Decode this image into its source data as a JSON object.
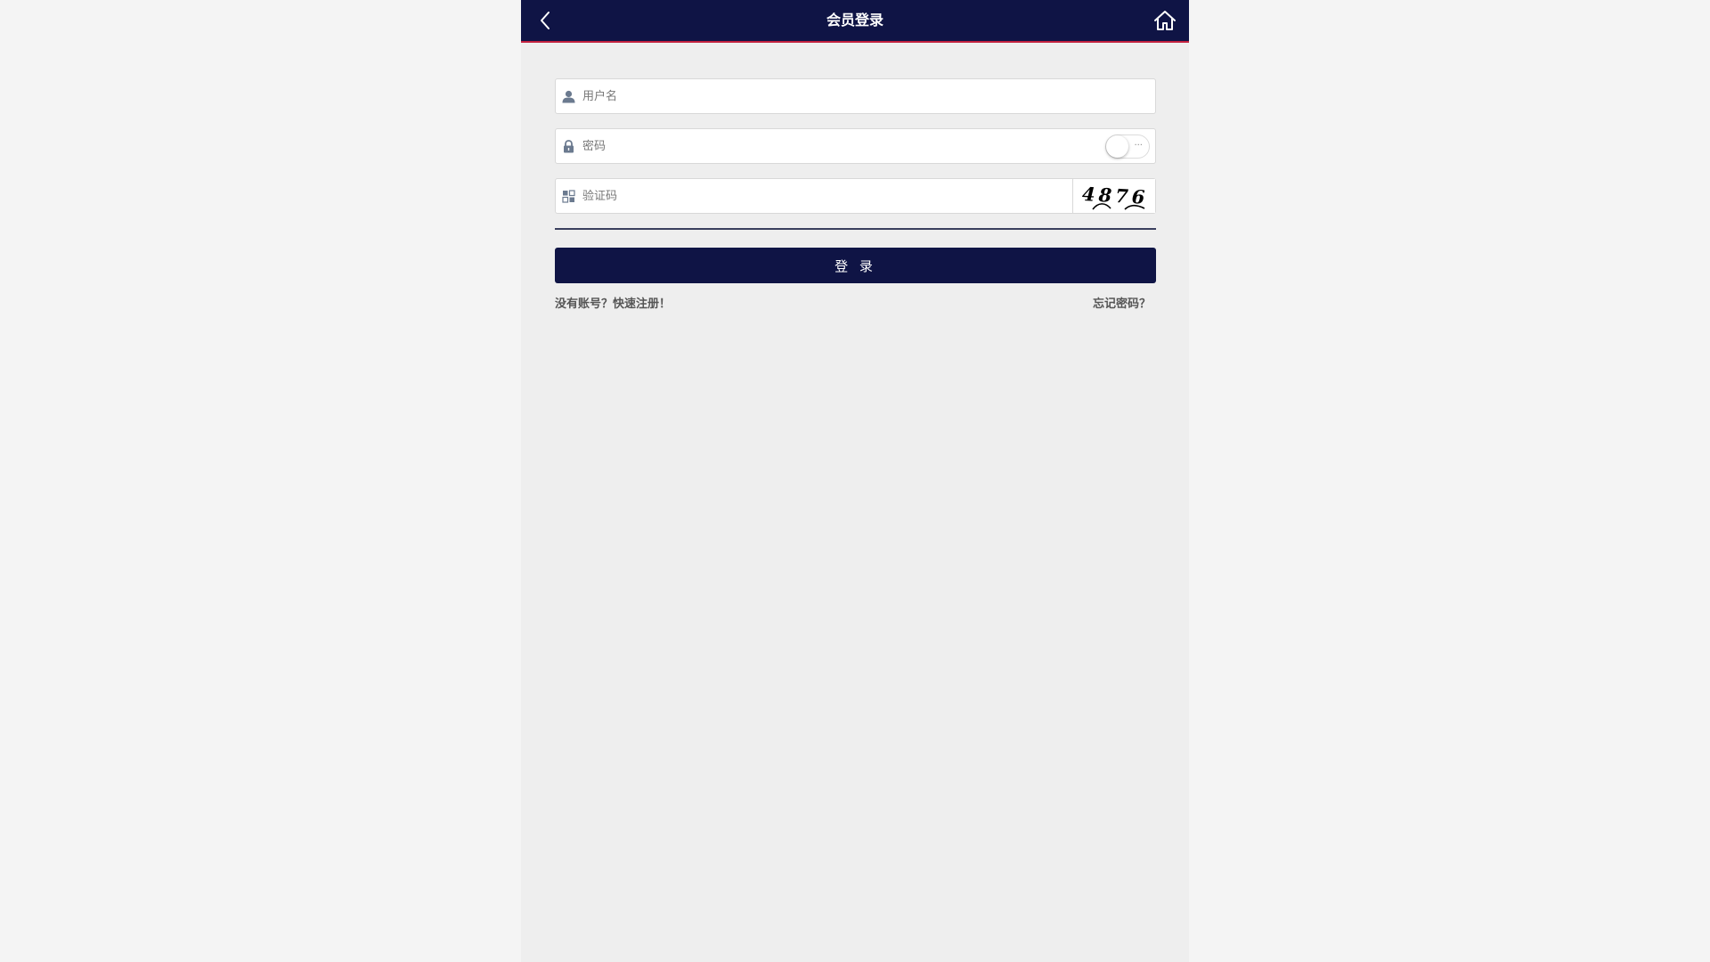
{
  "header": {
    "title": "会员登录",
    "back_icon": "chevron-left-icon",
    "home_icon": "home-icon"
  },
  "form": {
    "username": {
      "placeholder": "用户名",
      "value": "",
      "icon": "user-icon"
    },
    "password": {
      "placeholder": "密码",
      "value": "",
      "icon": "lock-icon",
      "show_password_toggle": false,
      "toggle_dots": "···"
    },
    "captcha": {
      "placeholder": "验证码",
      "value": "",
      "icon": "grid-icon",
      "image_text": "4876"
    },
    "login_button": "登 录"
  },
  "links": {
    "register": "没有账号？快速注册！",
    "forgot": "忘记密码？"
  },
  "colors": {
    "header_bg": "#0f1445",
    "header_accent": "#c2213f",
    "button_bg": "#0f1445",
    "page_bg": "#eeeeee",
    "outer_bg": "#f4f4f4"
  }
}
